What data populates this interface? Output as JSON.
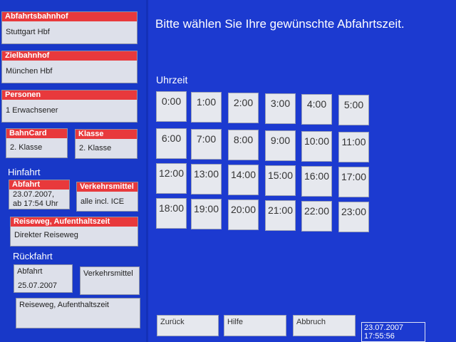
{
  "prompt": "Bitte wählen Sie Ihre gewünschte Abfahrtszeit.",
  "uhrzeit_label": "Uhrzeit",
  "times": [
    "0:00",
    "1:00",
    "2:00",
    "3:00",
    "4:00",
    "5:00",
    "6:00",
    "7:00",
    "8:00",
    "9:00",
    "10:00",
    "11:00",
    "12:00",
    "13:00",
    "14:00",
    "15:00",
    "16:00",
    "17:00",
    "18:00",
    "19:00",
    "20:00",
    "21:00",
    "22:00",
    "23:00"
  ],
  "abfahrtsbahnhof": {
    "label": "Abfahrtsbahnhof",
    "value": "Stuttgart Hbf"
  },
  "zielbahnhof": {
    "label": "Zielbahnhof",
    "value": "München Hbf"
  },
  "personen": {
    "label": "Personen",
    "value": "1 Erwachsener"
  },
  "bahncard": {
    "label": "BahnCard",
    "value": "2. Klasse"
  },
  "klasse": {
    "label": "Klasse",
    "value": "2. Klasse"
  },
  "hinfahrt": {
    "title": "Hinfahrt",
    "abfahrt": {
      "label": "Abfahrt",
      "line1": "23.07.2007,",
      "line2": "ab 17:54 Uhr"
    },
    "verkehrsmittel": {
      "label": "Verkehrsmittel",
      "value": "alle incl. ICE"
    },
    "reiseweg": {
      "label": "Reiseweg, Aufenthaltszeit",
      "value": "Direkter Reiseweg"
    }
  },
  "rueckfahrt": {
    "title": "Rückfahrt",
    "abfahrt": {
      "label": "Abfahrt",
      "value": "25.07.2007"
    },
    "verkehrsmittel": {
      "label": "Verkehrsmittel"
    },
    "reiseweg": {
      "label": "Reiseweg, Aufenthaltszeit"
    }
  },
  "buttons": {
    "zurueck": "Zurück",
    "hilfe": "Hilfe",
    "abbruch": "Abbruch"
  },
  "datetime": {
    "date": "23.07.2007",
    "time": "17:55:56"
  }
}
